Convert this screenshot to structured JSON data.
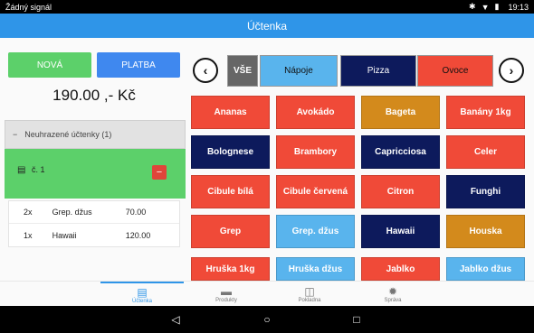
{
  "status_bar": {
    "carrier": "Žádný signál",
    "time": "19:13"
  },
  "app_bar": {
    "title": "Účtenka"
  },
  "actions": {
    "new_label": "NOVÁ",
    "pay_label": "PLATBA"
  },
  "total": {
    "amount": "190.00 ,- Kč"
  },
  "accordion": {
    "toggle": "−",
    "title": "Neuhrazené účtenky (1)"
  },
  "receipt": {
    "icon": "receipt-icon",
    "number": "č. 1",
    "delete_label": "−"
  },
  "receipt_items": [
    {
      "qty": "2x",
      "name": "Grep. džus",
      "price": "70.00"
    },
    {
      "qty": "1x",
      "name": "Hawaii",
      "price": "120.00"
    }
  ],
  "nav": {
    "prev": "‹",
    "next": "›"
  },
  "categories": [
    {
      "label": "VŠE",
      "color": "#666666"
    },
    {
      "label": "Nápoje",
      "color": "#59b4ed"
    },
    {
      "label": "Pizza",
      "color": "#0d1a5c"
    },
    {
      "label": "Ovoce",
      "color": "#f04a38"
    }
  ],
  "products": [
    {
      "label": "Ananas",
      "color": "red"
    },
    {
      "label": "Avokádo",
      "color": "red"
    },
    {
      "label": "Bageta",
      "color": "gold"
    },
    {
      "label": "Banány 1kg",
      "color": "red"
    },
    {
      "label": "Bolognese",
      "color": "navy"
    },
    {
      "label": "Brambory",
      "color": "red"
    },
    {
      "label": "Capricciosa",
      "color": "navy"
    },
    {
      "label": "Celer",
      "color": "red"
    },
    {
      "label": "Cibule bílá",
      "color": "red"
    },
    {
      "label": "Cibule červená",
      "color": "red"
    },
    {
      "label": "Citron",
      "color": "red"
    },
    {
      "label": "Funghi",
      "color": "navy"
    },
    {
      "label": "Grep",
      "color": "red"
    },
    {
      "label": "Grep. džus",
      "color": "blue"
    },
    {
      "label": "Hawaii",
      "color": "navy"
    },
    {
      "label": "Houska",
      "color": "gold"
    },
    {
      "label": "Hruška 1kg",
      "color": "red"
    },
    {
      "label": "Hruška džus",
      "color": "blue"
    },
    {
      "label": "Jablko",
      "color": "red"
    },
    {
      "label": "Jablko džus",
      "color": "blue"
    }
  ],
  "bottom_nav": [
    {
      "label": "Účtenka",
      "icon": "receipt-icon",
      "active": true
    },
    {
      "label": "Produkty",
      "icon": "folder-icon",
      "active": false
    },
    {
      "label": "Pokladna",
      "icon": "cash-icon",
      "active": false
    },
    {
      "label": "Správa",
      "icon": "gear-icon",
      "active": false
    }
  ],
  "colors": {
    "accent": "#2f95e8",
    "success": "#5cd06a",
    "danger": "#e0453a"
  }
}
